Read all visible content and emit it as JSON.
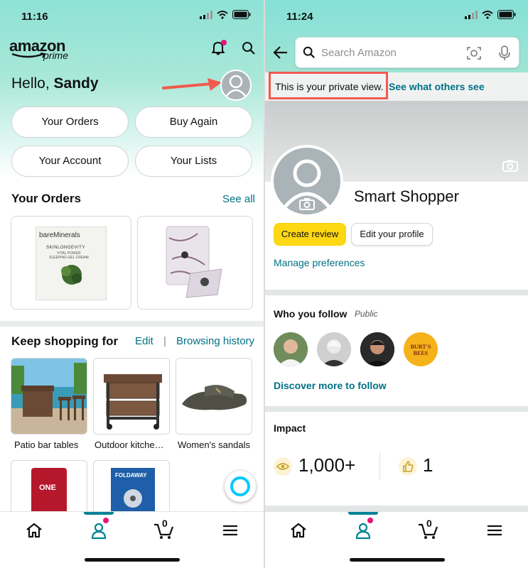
{
  "left": {
    "status_time": "11:16",
    "logo_word": "amazon",
    "logo_sub": "prime",
    "greeting_prefix": "Hello,",
    "greeting_name": "Sandy",
    "buttons": [
      "Your Orders",
      "Buy Again",
      "Your Account",
      "Your Lists"
    ],
    "orders_title": "Your Orders",
    "orders_see_all": "See all",
    "order_items": [
      {
        "brand": "bareMinerals",
        "line": "SKINLONGEVITY",
        "desc": "VITAL POWER\nSLEEPING GEL CREAM"
      },
      {
        "brand": "",
        "line": "",
        "desc": ""
      }
    ],
    "keep_title": "Keep shopping for",
    "keep_edit": "Edit",
    "keep_sep": "|",
    "keep_history": "Browsing history",
    "keep_items": [
      "Patio bar tables",
      "Outdoor kitche…",
      "Women's sandals"
    ],
    "more_items": [
      {
        "brand": "ONE"
      },
      {
        "brand": "FOLDAWAY"
      }
    ],
    "cart_count": "0"
  },
  "right": {
    "status_time": "11:24",
    "search_placeholder": "Search Amazon",
    "private_view": "This is your private view.",
    "see_others": "See what others see",
    "profile_name": "Smart Shopper",
    "create_review": "Create review",
    "edit_profile": "Edit your profile",
    "manage_prefs": "Manage preferences",
    "follow_title": "Who you follow",
    "follow_public": "Public",
    "follow_badge_text": "BURT'S BEES",
    "discover": "Discover more to follow",
    "impact_title": "Impact",
    "impact_views": "1,000+",
    "impact_likes": "1",
    "cart_count": "0"
  },
  "colors": {
    "link": "#007185",
    "yellow": "#ffd814",
    "annotation_red": "#f05a4f",
    "teal_gradient_top": "#8ee2d6",
    "active_tab": "#008296"
  },
  "icons": [
    "bell-icon",
    "search-icon",
    "camera-icon",
    "mic-icon",
    "back-arrow-icon",
    "home-icon",
    "profile-icon",
    "cart-icon",
    "menu-icon",
    "alexa-icon",
    "eye-icon",
    "thumbs-up-icon"
  ]
}
